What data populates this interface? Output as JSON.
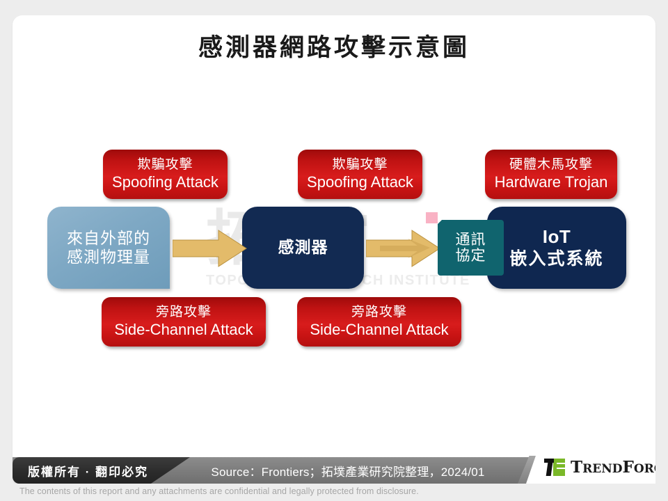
{
  "slide": {
    "title": "感測器網路攻擊示意圖",
    "watermark": {
      "logo": "拓墣T",
      "subtitle": "TOPOLOGY RESEARCH INSTITUTE"
    }
  },
  "diagram": {
    "flow_nodes": [
      {
        "id": "external-input",
        "cn": "來自外部的",
        "cn2": "感測物理量",
        "color": "#7ea8c4"
      },
      {
        "id": "sensor",
        "cn": "感測器",
        "color": "#122a52"
      },
      {
        "id": "protocol",
        "cn": "通訊",
        "cn2": "協定",
        "color": "#10646e"
      },
      {
        "id": "iot-system",
        "en": "IoT",
        "cn": "嵌入式系統",
        "color": "#0f2750"
      }
    ],
    "attack_boxes": [
      {
        "id": "spoofing-sensor-input",
        "cn": "欺騙攻擊",
        "en": "Spoofing Attack",
        "position": "top-left"
      },
      {
        "id": "spoofing-sensor-output",
        "cn": "欺騙攻擊",
        "en": "Spoofing Attack",
        "position": "top-center"
      },
      {
        "id": "hardware-trojan",
        "cn": "硬體木馬攻擊",
        "en": "Hardware Trojan",
        "position": "top-right"
      },
      {
        "id": "side-channel-left",
        "cn": "旁路攻擊",
        "en": "Side-Channel Attack",
        "position": "bottom-left"
      },
      {
        "id": "side-channel-center",
        "cn": "旁路攻擊",
        "en": "Side-Channel Attack",
        "position": "bottom-center"
      }
    ],
    "accent_color": "#e3bb6a",
    "attack_color": "#cc1515",
    "pink_marker_color": "#f9b2c4"
  },
  "footer": {
    "copyright": "版權所有 · 翻印必究",
    "source": "Source：Frontiers；拓墣產業研究院整理，2024/01",
    "brand_lead": "T",
    "brand_rest": "REND",
    "brand_lead2": "F",
    "brand_rest2": "ORCE",
    "disclaimer": "The contents of this report and any attachments are confidential and legally protected from disclosure."
  }
}
